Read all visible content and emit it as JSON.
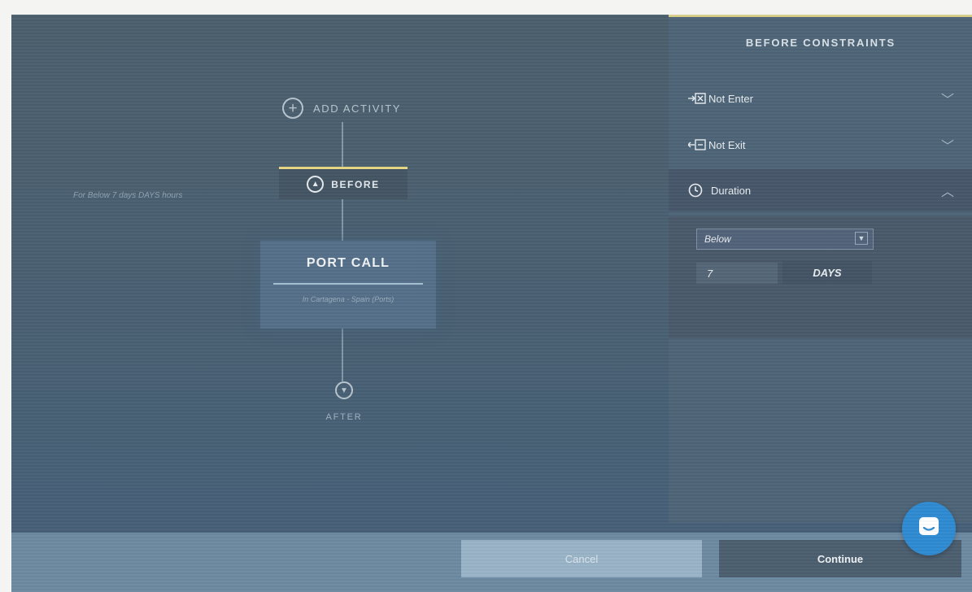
{
  "flow": {
    "add_activity_label": "ADD ACTIVITY",
    "constraint_summary": "For Below 7 days DAYS hours",
    "before_tab_label": "BEFORE",
    "activity_card": {
      "title": "PORT CALL",
      "subtitle": "In Cartagena - Spain (Ports)"
    },
    "after_label": "AFTER"
  },
  "panel": {
    "title": "BEFORE CONSTRAINTS",
    "constraints": [
      {
        "label": "Not Enter",
        "icon": "not-enter-icon",
        "expanded": false
      },
      {
        "label": "Not Exit",
        "icon": "not-exit-icon",
        "expanded": false
      },
      {
        "label": "Duration",
        "icon": "clock-icon",
        "expanded": true
      }
    ],
    "duration": {
      "comparator": "Below",
      "value": "7",
      "unit": "DAYS"
    }
  },
  "footer": {
    "cancel_label": "Cancel",
    "continue_label": "Continue"
  },
  "colors": {
    "accent_yellow": "#e6d683",
    "chat_button": "#2f8bd2",
    "background": "#4a6072"
  }
}
